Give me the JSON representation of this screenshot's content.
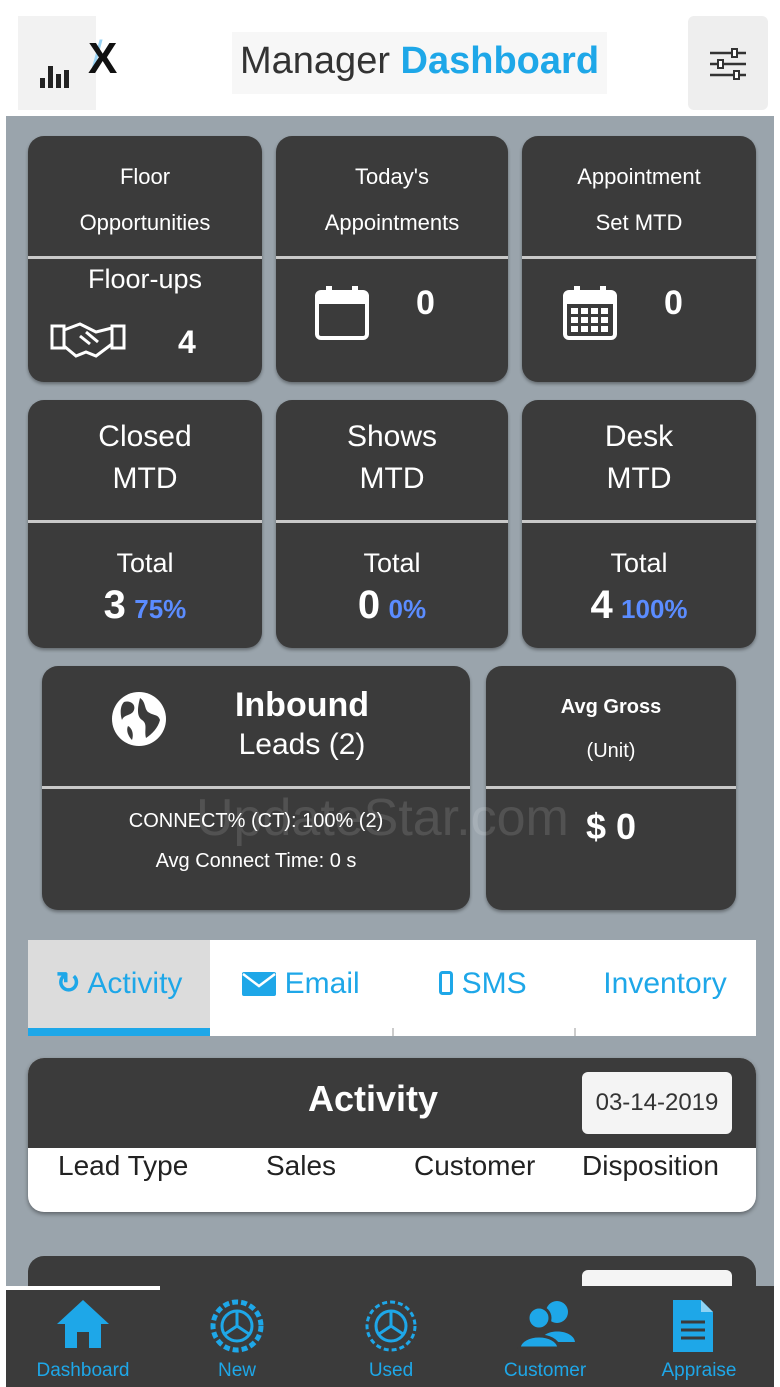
{
  "header": {
    "logo_text": "X",
    "title_plain": "Manager",
    "title_accent": "Dashboard"
  },
  "tiles_row1": [
    {
      "line1": "Floor",
      "line2": "Opportunities",
      "sub_label": "Floor-ups",
      "value": "4",
      "icon": "handshake-icon"
    },
    {
      "line1": "Today's",
      "line2": "Appointments",
      "value": "0",
      "icon": "calendar-icon"
    },
    {
      "line1": "Appointment",
      "line2": "Set MTD",
      "value": "0",
      "icon": "calendar-grid-icon"
    }
  ],
  "tiles_row2": [
    {
      "line1": "Closed",
      "line2": "MTD",
      "total_label": "Total",
      "value": "3",
      "percent": "75%"
    },
    {
      "line1": "Shows",
      "line2": "MTD",
      "total_label": "Total",
      "value": "0",
      "percent": "0%"
    },
    {
      "line1": "Desk",
      "line2": "MTD",
      "total_label": "Total",
      "value": "4",
      "percent": "100%"
    }
  ],
  "inbound": {
    "line1": "Inbound",
    "line2": "Leads (2)",
    "connect": "CONNECT% (CT): 100% (2)",
    "avg_time": "Avg Connect Time: 0 s",
    "icon": "globe-icon"
  },
  "avg_gross": {
    "line1": "Avg Gross",
    "line2": "(Unit)",
    "value": "$ 0"
  },
  "tabs": [
    {
      "label": "Activity",
      "icon": "refresh-icon",
      "active": true
    },
    {
      "label": "Email",
      "icon": "envelope-icon"
    },
    {
      "label": "SMS",
      "icon": "mobile-icon"
    },
    {
      "label": "Inventory"
    }
  ],
  "activity": {
    "title": "Activity",
    "date": "03-14-2019",
    "columns": [
      "Lead Type",
      "Sales",
      "Customer",
      "Disposition"
    ]
  },
  "bottom_nav": [
    {
      "label": "Dashboard",
      "icon": "home-icon",
      "active": true
    },
    {
      "label": "New",
      "icon": "wheel-icon"
    },
    {
      "label": "Used",
      "icon": "wheel-icon"
    },
    {
      "label": "Customer",
      "icon": "users-icon"
    },
    {
      "label": "Appraise",
      "icon": "document-icon"
    }
  ],
  "watermark": "UpdateStar.com",
  "colors": {
    "accent": "#1ea7e8",
    "tile_bg": "#3b3b3b",
    "page_bg": "#9aa4ac",
    "percent": "#5b8cff"
  }
}
